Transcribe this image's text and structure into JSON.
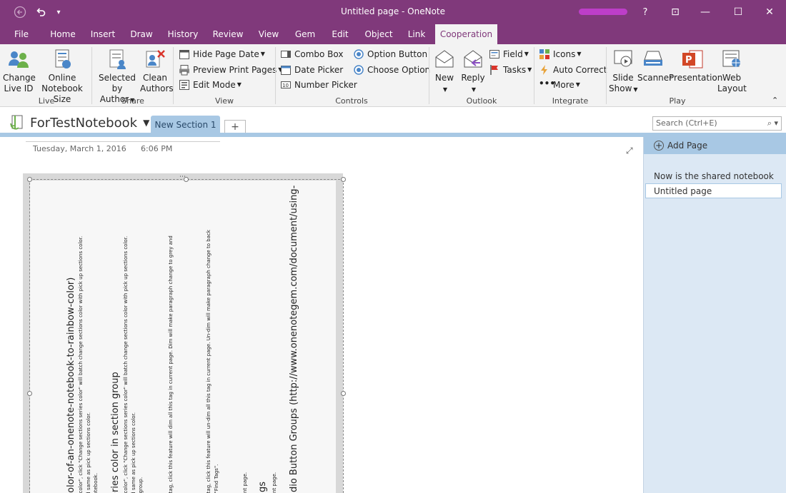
{
  "window": {
    "title": "Untitled page - OneNote",
    "help": "?",
    "controls": [
      "⊡",
      "—",
      "☐",
      "✕"
    ]
  },
  "quick_access": {
    "back": "◀",
    "undo": "↶",
    "more": "▾"
  },
  "tabs": [
    {
      "label": "File"
    },
    {
      "label": "Home"
    },
    {
      "label": "Insert"
    },
    {
      "label": "Draw"
    },
    {
      "label": "History"
    },
    {
      "label": "Review"
    },
    {
      "label": "View"
    },
    {
      "label": "Gem"
    },
    {
      "label": "Edit"
    },
    {
      "label": "Object"
    },
    {
      "label": "Link"
    },
    {
      "label": "Cooperation"
    }
  ],
  "ribbon": {
    "live": {
      "label": "Live",
      "change_live_id": "Change\nLive ID",
      "online_notebook_size": "Online\nNotebook Size"
    },
    "share": {
      "label": "Share",
      "selected_by_author": "Selected by\nAuthor",
      "clean_authors": "Clean\nAuthors"
    },
    "view": {
      "label": "View",
      "hide_page_date": "Hide Page Date",
      "preview_print_pages": "Preview Print Pages",
      "edit_mode": "Edit Mode"
    },
    "controls": {
      "label": "Controls",
      "combo_box": "Combo Box",
      "date_picker": "Date Picker",
      "number_picker": "Number Picker",
      "option_button": "Option Button",
      "choose_option": "Choose Option"
    },
    "outlook": {
      "label": "Outlook",
      "new": "New",
      "reply": "Reply",
      "field": "Field",
      "tasks": "Tasks"
    },
    "integrate": {
      "label": "Integrate",
      "icons": "Icons",
      "auto_correct": "Auto Correct",
      "more": "More"
    },
    "play": {
      "label": "Play",
      "slide_show": "Slide\nShow",
      "scanner": "Scanner",
      "presentation": "Presentation",
      "web_layout": "Web\nLayout"
    }
  },
  "notebook": {
    "name": "ForTestNotebook",
    "section": "New Section 1",
    "add_section": "+",
    "search_placeholder": "Search (Ctrl+E)"
  },
  "page": {
    "date": "Tuesday, March 1, 2016",
    "time": "6:06 PM"
  },
  "image_text": [
    "color-of-an-onenote-notebook-to-rainbow-color)",
    "o color\", click \"Change sections series color\" will batch change sections color with pick up sections color.",
    "ed same as pick up sections color.",
    "notebook.",
    "eries color in section group",
    "o color\", click \"Change sections series color\" will batch change sections color with pick up sections color.",
    "ed same as pick up sections color.",
    "n group.",
    "h tag, click this feature will dim all this tag in current page. Dim will make paragraph change to grey and",
    "h tag, click this feature will un-dim all this tag in current page. Un-dim will make paragraph change to back",
    "u \"Find Tags\".",
    "s",
    "rent page.",
    "ags",
    "rent page.",
    "adio Button Groups (http://www.onenotegem.com/document/using-"
  ],
  "pagelist": {
    "add_page": "Add Page",
    "pages": [
      "Now is the shared notebook",
      "Untitled page"
    ]
  },
  "colors": {
    "accent": "#80397b",
    "section": "#a8c8e4",
    "pagelist_bg": "#dce8f4"
  }
}
